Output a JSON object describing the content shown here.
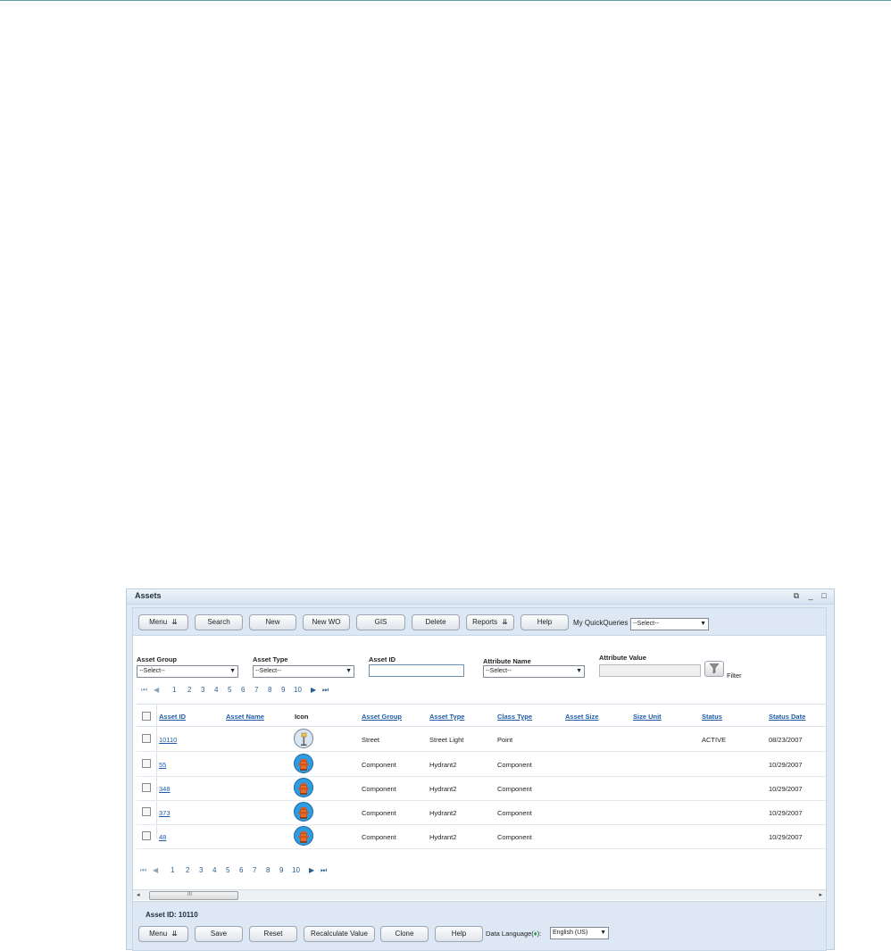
{
  "window": {
    "title": "Assets",
    "controls": {
      "restore": "⧉",
      "minimize": "_",
      "maximize": "□"
    }
  },
  "toolbar": {
    "menu": "Menu",
    "search": "Search",
    "new": "New",
    "new_wo": "New WO",
    "gis": "GIS",
    "delete": "Delete",
    "reports": "Reports",
    "help": "Help",
    "quickqueries_label": "My QuickQueries",
    "quickqueries_value": "--Select--",
    "dropdown_glyph": "⇊"
  },
  "filters": {
    "asset_group": {
      "label": "Asset Group",
      "value": "--Select--"
    },
    "asset_type": {
      "label": "Asset Type",
      "value": "--Select--"
    },
    "asset_id": {
      "label": "Asset ID",
      "value": ""
    },
    "attribute_name": {
      "label": "Attribute Name",
      "value": "--Select--"
    },
    "attribute_value": {
      "label": "Attribute Value",
      "value": ""
    },
    "filter_label": "Filter"
  },
  "pager": {
    "first": "⏮",
    "prev": "◀",
    "pages": [
      "1",
      "2",
      "3",
      "4",
      "5",
      "6",
      "7",
      "8",
      "9",
      "10"
    ],
    "next": "▶",
    "last": "⏭"
  },
  "grid": {
    "columns": [
      "Asset ID",
      "Asset Name",
      "Icon",
      "Asset Group",
      "Asset Type",
      "Class Type",
      "Asset Size",
      "Size Unit",
      "Status",
      "Status Date"
    ],
    "rows": [
      {
        "asset_id": "10110",
        "asset_name": "",
        "icon": "street-light-icon",
        "asset_group": "Street",
        "asset_type": "Street Light",
        "class_type": "Point",
        "asset_size": "",
        "size_unit": "",
        "status": "ACTIVE",
        "status_date": "08/23/2007"
      },
      {
        "asset_id": "55",
        "asset_name": "",
        "icon": "hydrant-icon",
        "asset_group": "Component",
        "asset_type": "Hydrant2",
        "class_type": "Component",
        "asset_size": "",
        "size_unit": "",
        "status": "",
        "status_date": "10/29/2007"
      },
      {
        "asset_id": "348",
        "asset_name": "",
        "icon": "hydrant-icon",
        "asset_group": "Component",
        "asset_type": "Hydrant2",
        "class_type": "Component",
        "asset_size": "",
        "size_unit": "",
        "status": "",
        "status_date": "10/29/2007"
      },
      {
        "asset_id": "373",
        "asset_name": "",
        "icon": "hydrant-icon",
        "asset_group": "Component",
        "asset_type": "Hydrant2",
        "class_type": "Component",
        "asset_size": "",
        "size_unit": "",
        "status": "",
        "status_date": "10/29/2007"
      },
      {
        "asset_id": "48",
        "asset_name": "",
        "icon": "hydrant-icon",
        "asset_group": "Component",
        "asset_type": "Hydrant2",
        "class_type": "Component",
        "asset_size": "",
        "size_unit": "",
        "status": "",
        "status_date": "10/29/2007"
      }
    ]
  },
  "scrollbar": {
    "left": "◂",
    "right": "▸",
    "grip": "III"
  },
  "footer": {
    "asset_id_label": "Asset ID: 10110",
    "menu": "Menu",
    "save": "Save",
    "reset": "Reset",
    "recalculate": "Recalculate Value",
    "clone": "Clone",
    "help": "Help",
    "data_language_label": "Data Language(",
    "data_language_mark": "♦",
    "data_language_suffix": "):",
    "data_language_value": "English (US)"
  }
}
